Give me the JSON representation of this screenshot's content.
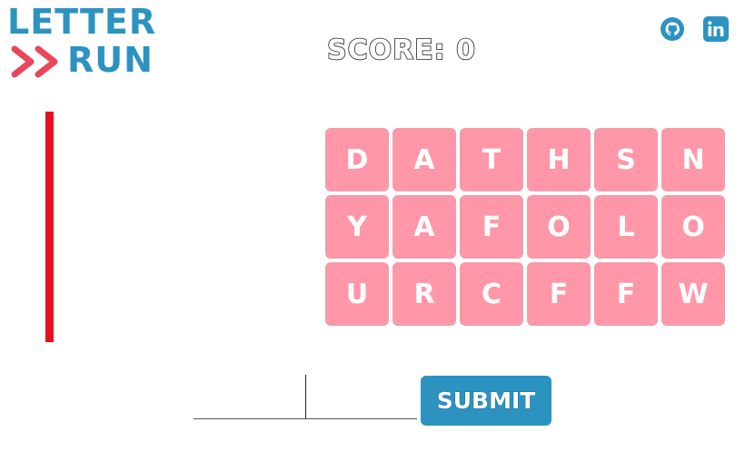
{
  "logo": {
    "line1": "LETTER",
    "line2": "RUN",
    "chevron_icon": "double-chevron-right",
    "primary_color": "#2c93c1",
    "accent_color": "#e8475c"
  },
  "score": {
    "label": "SCORE: 0"
  },
  "social": {
    "github_icon": "github-icon",
    "linkedin_icon": "linkedin-icon",
    "color": "#2c93c1"
  },
  "timer": {
    "color": "#e8101f"
  },
  "grid": {
    "tile_color": "#ff97a8",
    "rows": [
      [
        "D",
        "A",
        "T",
        "H",
        "S",
        "N"
      ],
      [
        "Y",
        "A",
        "F",
        "O",
        "L",
        "O"
      ],
      [
        "U",
        "R",
        "C",
        "F",
        "F",
        "W"
      ]
    ]
  },
  "input": {
    "value": "",
    "placeholder": ""
  },
  "submit": {
    "label": "SUBMIT"
  }
}
